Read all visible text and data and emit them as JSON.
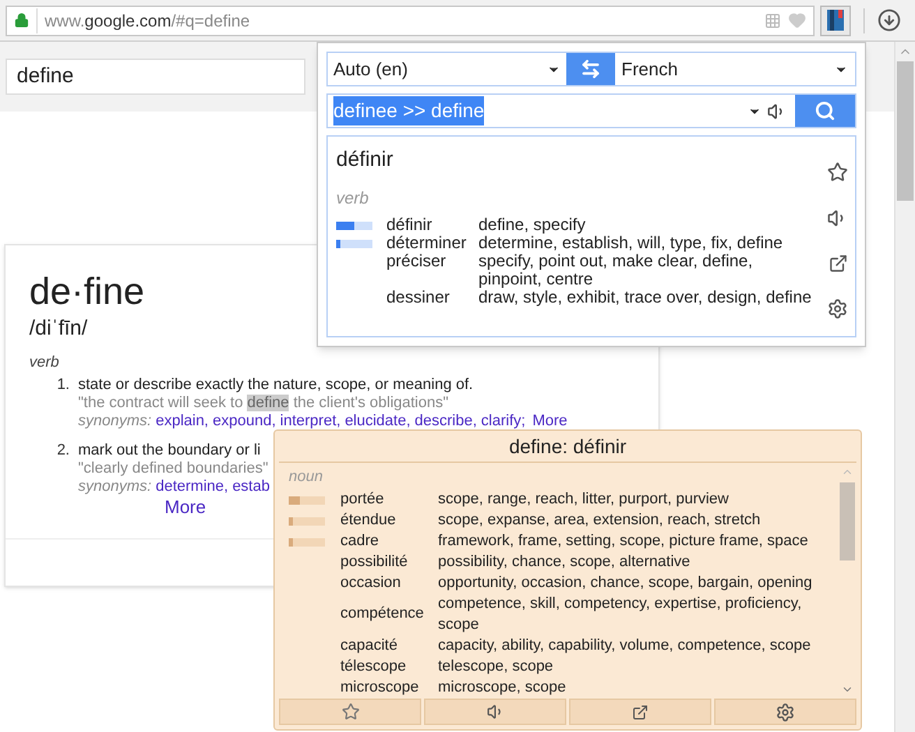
{
  "address_bar": {
    "url_prefix": "www.",
    "url_domain": "google.com",
    "url_path": "/#q=define"
  },
  "search": {
    "value": "define"
  },
  "dictionary_card": {
    "headword": "de·fine",
    "pronunciation": "/diˈfīn/",
    "part_of_speech": "verb",
    "senses": [
      {
        "number": "1.",
        "definition": "state or describe exactly the nature, scope, or meaning of.",
        "example": {
          "before": "\"the contract will seek to ",
          "highlight": "define",
          "after": " the client's obligations\""
        },
        "synonyms_label": "synonyms:",
        "synonyms": [
          "explain,",
          "expound,",
          "interpret,",
          "elucidate,",
          "describe,",
          "clarify;"
        ],
        "more": "More"
      },
      {
        "number": "2.",
        "definition": "mark out the boundary or li",
        "example": {
          "before": "\"clearly defined boundaries\""
        },
        "synonyms_label": "synonyms:",
        "synonyms": [
          "determine,",
          "estab"
        ],
        "more": "More"
      }
    ]
  },
  "translator_popup": {
    "source_language": "Auto (en)",
    "target_language": "French",
    "input": "definee >> define",
    "result": {
      "title": "définir",
      "part_of_speech": "verb",
      "rows": [
        {
          "word": "définir",
          "meanings": "define, specify",
          "level": 0.5
        },
        {
          "word": "déterminer",
          "meanings": "determine, establish, will, type, fix, define",
          "level": 0.1
        },
        {
          "word": "préciser",
          "meanings": "specify, point out, make clear, define, pinpoint, centre"
        },
        {
          "word": "dessiner",
          "meanings": "draw, style, exhibit, trace over, design, define"
        }
      ]
    }
  },
  "inline_popup": {
    "title": "define: définir",
    "part_of_speech": "noun",
    "rows": [
      {
        "word": "portée",
        "meanings": "scope, range, reach, litter, purport, purview",
        "level": 0.3
      },
      {
        "word": "étendue",
        "meanings": "scope, expanse, area, extension, reach, stretch",
        "level": 0.12
      },
      {
        "word": "cadre",
        "meanings": "framework, frame, setting, scope, picture frame, space",
        "level": 0.12
      },
      {
        "word": "possibilité",
        "meanings": "possibility, chance, scope, alternative"
      },
      {
        "word": "occasion",
        "meanings": "opportunity, occasion, chance, scope, bargain, opening"
      },
      {
        "word": "compétence",
        "meanings": "competence, skill, competency, expertise, proficiency, scope"
      },
      {
        "word": "capacité",
        "meanings": "capacity, ability, capability, volume, competence, scope"
      },
      {
        "word": "télescope",
        "meanings": "telescope, scope"
      },
      {
        "word": "microscope",
        "meanings": "microscope, scope"
      }
    ]
  }
}
